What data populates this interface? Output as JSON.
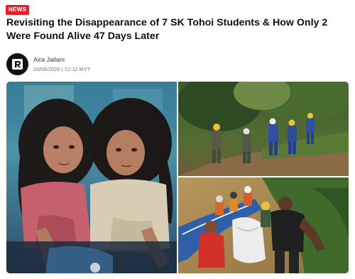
{
  "badge": {
    "label": "NEWS"
  },
  "article": {
    "title": "Revisiting the Disappearance of 7 SK Tohoi Students & How Only 2 Were Found Alive 47 Days Later"
  },
  "author": {
    "name": "Aira Jailani",
    "date": "03/06/2026",
    "separator": "|",
    "time": "12:12 MYT",
    "avatar_letter": "R"
  },
  "colors": {
    "badge_bg": "#e0202f",
    "avatar_bg": "#111111"
  },
  "images": {
    "left": "photo-two-girls",
    "top_right": "photo-rescue-team-hillside",
    "bottom_right": "photo-rescuers-at-riverbank"
  }
}
